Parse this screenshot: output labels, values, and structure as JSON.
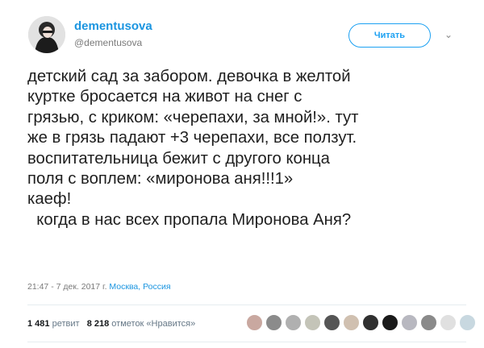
{
  "user": {
    "name": "dementusova",
    "handle": "@dementusova",
    "follow_label": "Читать"
  },
  "tweet": {
    "text": "детский сад за забором. девочка в желтой\nкуртке бросается на живот на снег с\nгрязью, с криком: «черепахи, за мной!». тут\nже в грязь падают +3 черепахи, все ползут.\nвоспитательница бежит с другого конца\nполя с воплем: «миронова аня!!!1»\nкаеф!\n  когда в нас всех пропала Миронова Аня?",
    "time": "21:47 - 7 дек. 2017 г. ",
    "location": "Москва, Россия"
  },
  "stats": {
    "retweets_count": "1 481",
    "retweets_label": "ретвит",
    "likes_count": "8 218",
    "likes_label": "отметок «Нравится»"
  },
  "colors": {
    "link": "#1b95e0",
    "liker_avatars": [
      "#c9a8a0",
      "#8b8b8b",
      "#b0b0b0",
      "#c4c4b8",
      "#555555",
      "#d0c0b0",
      "#303030",
      "#1a1a1a",
      "#b8b8c0",
      "#8a8a8a",
      "#e0e0e0",
      "#c8d8e0"
    ]
  }
}
